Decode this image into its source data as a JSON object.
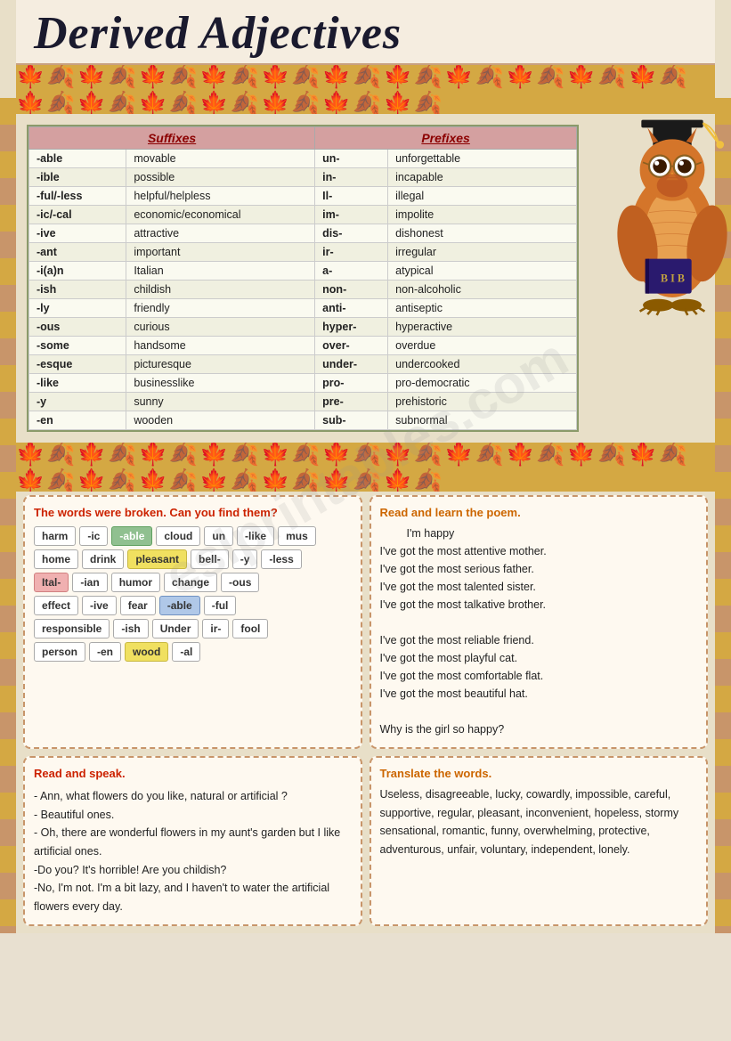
{
  "page": {
    "title": "Derived Adjectives",
    "colors": {
      "accent_red": "#cc2200",
      "accent_orange": "#cc6600",
      "leaf_bg": "#d4a843",
      "page_bg": "#e8dfc8"
    }
  },
  "table": {
    "suffixes_header": "Suffixes",
    "prefixes_header": "Prefixes",
    "rows": [
      {
        "suffix": "-able",
        "s_example": "movable",
        "prefix": "un-",
        "p_example": "unforgettable"
      },
      {
        "suffix": "-ible",
        "s_example": "possible",
        "prefix": "in-",
        "p_example": "incapable"
      },
      {
        "suffix": "-ful/-less",
        "s_example": "helpful/helpless",
        "prefix": "Il-",
        "p_example": "illegal"
      },
      {
        "suffix": "-ic/-cal",
        "s_example": "economic/economical",
        "prefix": "im-",
        "p_example": "impolite"
      },
      {
        "suffix": "-ive",
        "s_example": "attractive",
        "prefix": "dis-",
        "p_example": "dishonest"
      },
      {
        "suffix": "-ant",
        "s_example": "important",
        "prefix": "ir-",
        "p_example": "irregular"
      },
      {
        "suffix": "-i(a)n",
        "s_example": "Italian",
        "prefix": "a-",
        "p_example": "atypical"
      },
      {
        "suffix": "-ish",
        "s_example": "childish",
        "prefix": "non-",
        "p_example": "non-alcoholic"
      },
      {
        "suffix": "-ly",
        "s_example": "friendly",
        "prefix": "anti-",
        "p_example": "antiseptic"
      },
      {
        "suffix": "-ous",
        "s_example": "curious",
        "prefix": "hyper-",
        "p_example": "hyperactive"
      },
      {
        "suffix": "-some",
        "s_example": "handsome",
        "prefix": "over-",
        "p_example": "overdue"
      },
      {
        "suffix": "-esque",
        "s_example": "picturesque",
        "prefix": "under-",
        "p_example": "undercooked"
      },
      {
        "suffix": "-like",
        "s_example": "businesslike",
        "prefix": "pro-",
        "p_example": "pro-democratic"
      },
      {
        "suffix": "-y",
        "s_example": "sunny",
        "prefix": "pre-",
        "p_example": "prehistoric"
      },
      {
        "suffix": "-en",
        "s_example": "wooden",
        "prefix": "sub-",
        "p_example": "subnormal"
      }
    ]
  },
  "word_broken": {
    "title": "The words were broken. Can you find them?",
    "tiles_row1": [
      {
        "text": "harm",
        "style": "white"
      },
      {
        "text": "-ic",
        "style": "white"
      },
      {
        "text": "-able",
        "style": "green"
      },
      {
        "text": "cloud",
        "style": "white"
      },
      {
        "text": "un",
        "style": "white"
      },
      {
        "text": "-like",
        "style": "white"
      },
      {
        "text": "mus",
        "style": "white"
      }
    ],
    "tiles_row2": [
      {
        "text": "home",
        "style": "white"
      },
      {
        "text": "drink",
        "style": "white"
      },
      {
        "text": "pleasant",
        "style": "yellow"
      },
      {
        "text": "bell-",
        "style": "white"
      },
      {
        "text": "-y",
        "style": "white"
      },
      {
        "text": "-less",
        "style": "white"
      }
    ],
    "tiles_row3": [
      {
        "text": "Ital-",
        "style": "pink"
      },
      {
        "text": "-ian",
        "style": "white"
      },
      {
        "text": "humor",
        "style": "white"
      },
      {
        "text": "change",
        "style": "white"
      },
      {
        "text": "-ous",
        "style": "white"
      }
    ],
    "tiles_row4": [
      {
        "text": "effect",
        "style": "white"
      },
      {
        "text": "-ive",
        "style": "white"
      },
      {
        "text": "fear",
        "style": "white"
      },
      {
        "text": "-able",
        "style": "blue"
      },
      {
        "text": "-ful",
        "style": "white"
      }
    ],
    "tiles_row5": [
      {
        "text": "responsible",
        "style": "white"
      },
      {
        "text": "-ish",
        "style": "white"
      },
      {
        "text": "Under",
        "style": "white"
      },
      {
        "text": "ir-",
        "style": "white"
      },
      {
        "text": "fool",
        "style": "white"
      }
    ],
    "tiles_row6": [
      {
        "text": "person",
        "style": "white"
      },
      {
        "text": "-en",
        "style": "white"
      },
      {
        "text": "wood",
        "style": "yellow"
      },
      {
        "text": "-al",
        "style": "white"
      }
    ]
  },
  "poem": {
    "title": "Read and learn the poem.",
    "poem_title": "I'm happy",
    "lines": [
      "I've got the most attentive mother.",
      "I've got the most serious father.",
      "I've  got the most talented sister.",
      "I've got the most talkative brother.",
      "",
      "I've got the most reliable friend.",
      "I've got the most playful cat.",
      "I've got the most comfortable flat.",
      "I've got the most beautiful hat.",
      "",
      "Why is the girl so happy?"
    ]
  },
  "speak": {
    "title": "Read and speak.",
    "text": "- Ann, what flowers do you like, natural or artificial ?\n- Beautiful ones.\n- Oh, there are wonderful flowers in my aunt's garden but I like artificial ones.\n-Do you? It's horrible! Are you childish?\n-No, I'm not. I'm a bit lazy, and I haven't  to water the artificial flowers every day."
  },
  "translate": {
    "title": "Translate the words.",
    "text": "Useless, disagreeable,  lucky, cowardly, impossible, careful, supportive, regular, pleasant, inconvenient, hopeless, stormy sensational, romantic, funny, overwhelming, protective, adventurous, unfair, voluntary, independent, lonely."
  }
}
